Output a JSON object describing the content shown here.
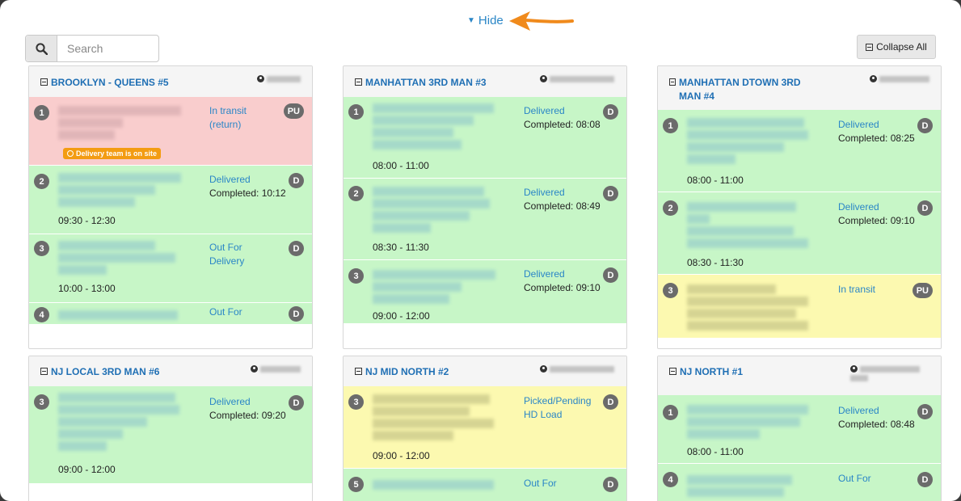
{
  "hide_label": "Hide",
  "search_placeholder": "Search",
  "collapse_label": "Collapse All",
  "routes": [
    {
      "title": "BROOKLYN - QUEENS #5",
      "stops": [
        {
          "num": "1",
          "status": "In transit (return)",
          "completed": "",
          "window": "",
          "badge": "PU",
          "tone": "red",
          "onsite": "Delivery team is on site"
        },
        {
          "num": "2",
          "status": "Delivered",
          "completed": "Completed: 10:12",
          "window": "09:30 - 12:30",
          "badge": "D",
          "tone": "green"
        },
        {
          "num": "3",
          "status": "Out For Delivery",
          "completed": "",
          "window": "10:00 - 13:00",
          "badge": "D",
          "tone": "green"
        },
        {
          "num": "4",
          "status": "Out For",
          "completed": "",
          "window": "",
          "badge": "D",
          "tone": "green"
        }
      ]
    },
    {
      "title": "MANHATTAN 3RD MAN #3",
      "stops": [
        {
          "num": "1",
          "status": "Delivered",
          "completed": "Completed: 08:08",
          "window": "08:00 - 11:00",
          "badge": "D",
          "tone": "green"
        },
        {
          "num": "2",
          "status": "Delivered",
          "completed": "Completed: 08:49",
          "window": "08:30 - 11:30",
          "badge": "D",
          "tone": "green"
        },
        {
          "num": "3",
          "status": "Delivered",
          "completed": "Completed: 09:10",
          "window": "09:00 - 12:00",
          "badge": "D",
          "tone": "green"
        }
      ]
    },
    {
      "title": "MANHATTAN DTOWN 3RD MAN #4",
      "stops": [
        {
          "num": "1",
          "status": "Delivered",
          "completed": "Completed: 08:25",
          "window": "08:00 - 11:00",
          "badge": "D",
          "tone": "green"
        },
        {
          "num": "2",
          "status": "Delivered",
          "completed": "Completed: 09:10",
          "window": "08:30 - 11:30",
          "badge": "D",
          "tone": "green"
        },
        {
          "num": "3",
          "status": "In transit",
          "completed": "",
          "window": "",
          "badge": "PU",
          "tone": "yellow"
        }
      ]
    },
    {
      "title": "NJ LOCAL 3RD MAN #6",
      "stops": [
        {
          "num": "3",
          "status": "Delivered",
          "completed": "Completed: 09:20",
          "window": "09:00 - 12:00",
          "badge": "D",
          "tone": "green"
        }
      ]
    },
    {
      "title": "NJ MID NORTH #2",
      "stops": [
        {
          "num": "3",
          "status": "Picked/Pending HD Load",
          "completed": "",
          "window": "09:00 - 12:00",
          "badge": "D",
          "tone": "yellow"
        },
        {
          "num": "5",
          "status": "Out For",
          "completed": "",
          "window": "",
          "badge": "D",
          "tone": "green"
        }
      ]
    },
    {
      "title": "NJ NORTH #1",
      "stops": [
        {
          "num": "1",
          "status": "Delivered",
          "completed": "Completed: 08:48",
          "window": "08:00 - 11:00",
          "badge": "D",
          "tone": "green"
        },
        {
          "num": "4",
          "status": "Out For",
          "completed": "",
          "window": "",
          "badge": "D",
          "tone": "green"
        }
      ]
    }
  ]
}
